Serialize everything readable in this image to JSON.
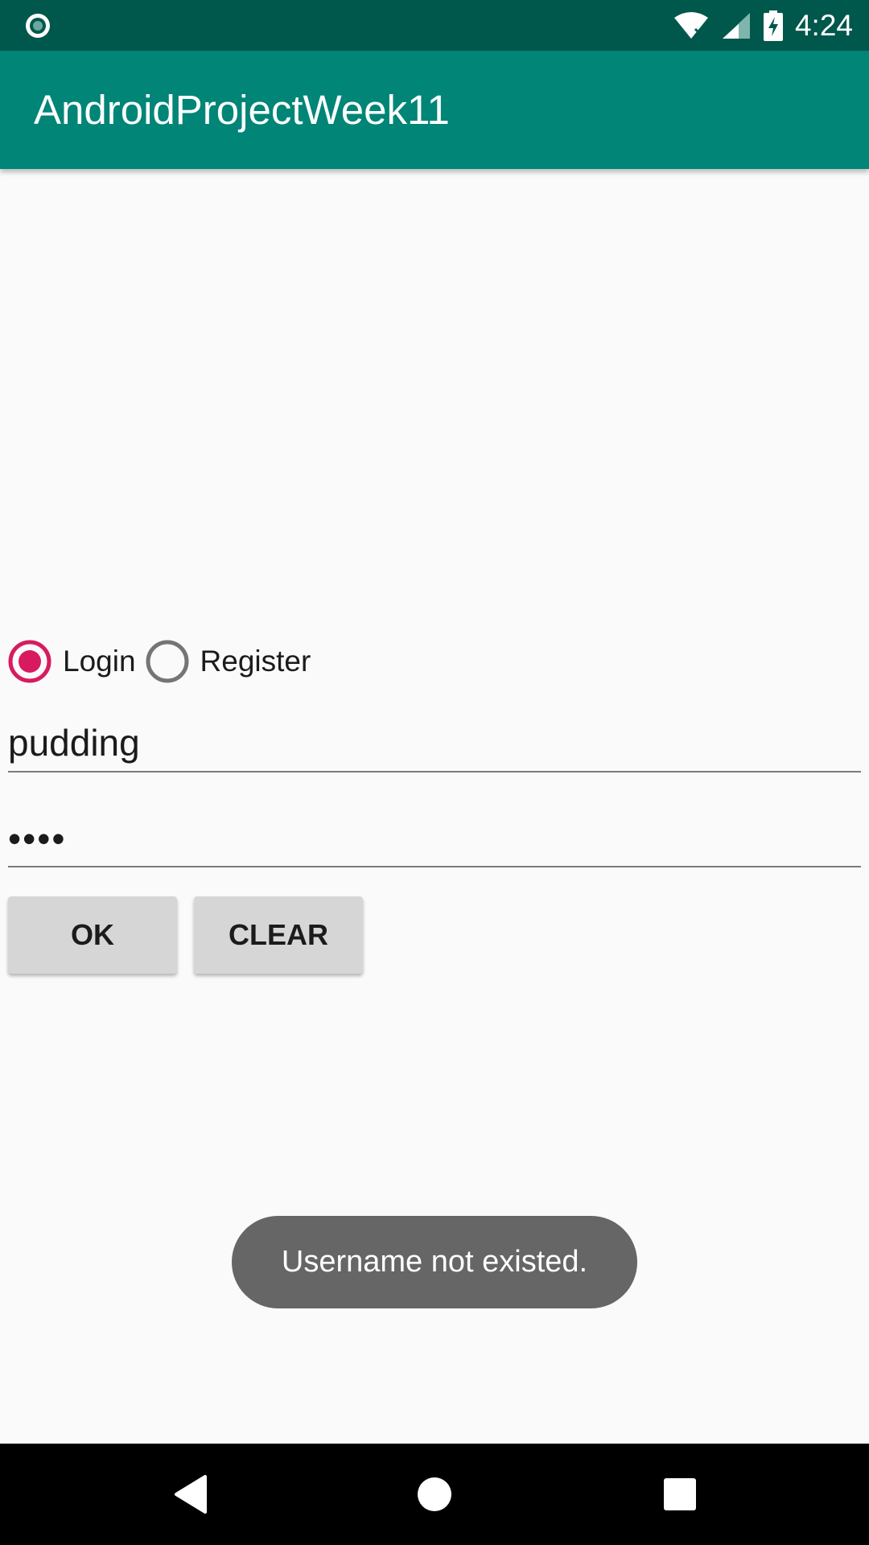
{
  "status_bar": {
    "time": "4:24",
    "icons": [
      "notification-circle-icon",
      "wifi-icon",
      "cellular-signal-icon",
      "battery-charging-icon"
    ]
  },
  "app_bar": {
    "title": "AndroidProjectWeek11",
    "color": "#008577"
  },
  "mode_selector": {
    "options": [
      {
        "label": "Login",
        "selected": true
      },
      {
        "label": "Register",
        "selected": false
      }
    ],
    "accent_color": "#d81b60"
  },
  "form": {
    "username": "pudding",
    "password": "••••"
  },
  "buttons": {
    "ok_label": "OK",
    "clear_label": "CLEAR"
  },
  "toast": {
    "message": "Username not existed."
  },
  "nav_bar": {
    "icons": [
      "back-icon",
      "home-icon",
      "recents-icon"
    ]
  }
}
